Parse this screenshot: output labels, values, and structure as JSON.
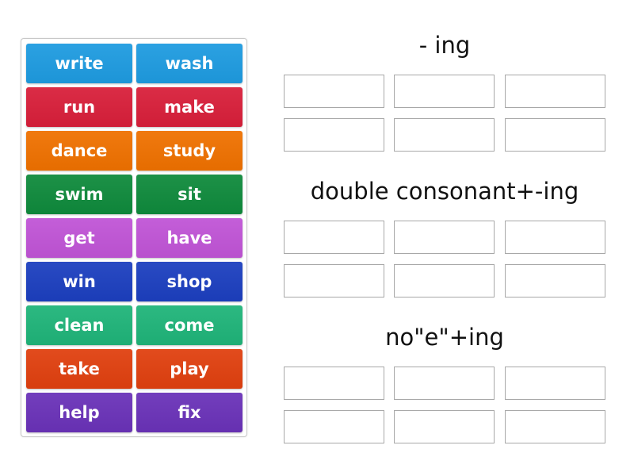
{
  "tiles": [
    {
      "label": "write",
      "color": "#1e9be0"
    },
    {
      "label": "wash",
      "color": "#1e9be0"
    },
    {
      "label": "run",
      "color": "#d81f3a"
    },
    {
      "label": "make",
      "color": "#d81f3a"
    },
    {
      "label": "dance",
      "color": "#ef7100"
    },
    {
      "label": "study",
      "color": "#ef7100"
    },
    {
      "label": "swim",
      "color": "#0f8a3c"
    },
    {
      "label": "sit",
      "color": "#0f8a3c"
    },
    {
      "label": "get",
      "color": "#c054d6"
    },
    {
      "label": "have",
      "color": "#c054d6"
    },
    {
      "label": "win",
      "color": "#1c3fbf"
    },
    {
      "label": "shop",
      "color": "#1c3fbf"
    },
    {
      "label": "clean",
      "color": "#1fb479"
    },
    {
      "label": "come",
      "color": "#1fb479"
    },
    {
      "label": "take",
      "color": "#e0400f"
    },
    {
      "label": "play",
      "color": "#e0400f"
    },
    {
      "label": "help",
      "color": "#6a32b8"
    },
    {
      "label": "fix",
      "color": "#6a32b8"
    }
  ],
  "groups": [
    {
      "title": "- ing",
      "slots": 6
    },
    {
      "title": "double consonant+-ing",
      "slots": 6
    },
    {
      "title": "no\"e\"+ing",
      "slots": 6
    }
  ]
}
